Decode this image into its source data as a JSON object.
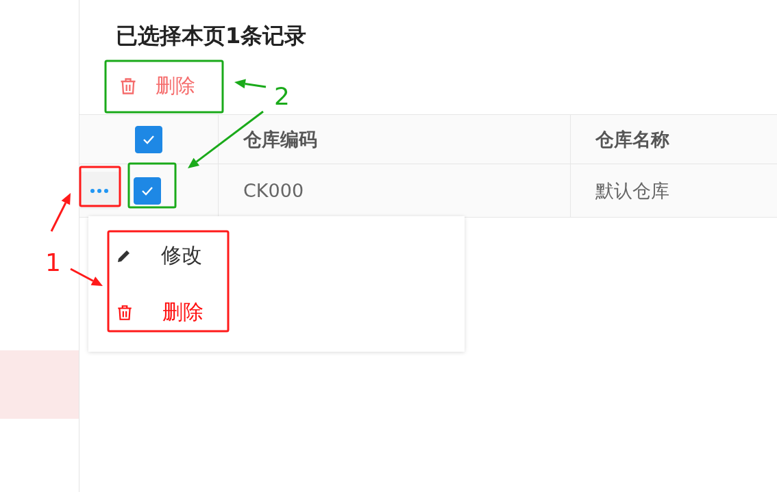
{
  "title": "已选择本页1条记录",
  "bulk_action": {
    "label": "删除"
  },
  "table": {
    "header_checked": true,
    "columns": [
      "仓库编码",
      "仓库名称"
    ],
    "rows": [
      {
        "checked": true,
        "cells": [
          "CK000",
          "默认仓库"
        ]
      }
    ]
  },
  "row_menu": [
    {
      "kind": "edit",
      "label": "修改"
    },
    {
      "kind": "delete",
      "label": "删除"
    }
  ],
  "annotations": [
    {
      "label": "1",
      "color": "#ff1a1a"
    },
    {
      "label": "2",
      "color": "#1aaa1a"
    }
  ]
}
